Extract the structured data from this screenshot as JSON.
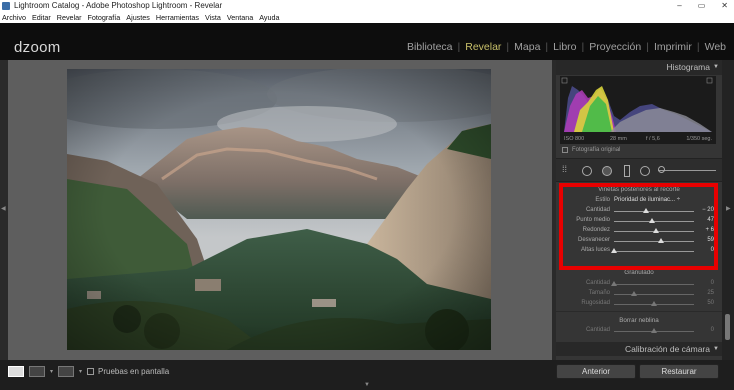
{
  "window": {
    "title": "Lightroom Catalog - Adobe Photoshop Lightroom - Revelar",
    "controls": [
      "–",
      "▭",
      "✕"
    ]
  },
  "menu": [
    "Archivo",
    "Editar",
    "Revelar",
    "Fotografía",
    "Ajustes",
    "Herramientas",
    "Vista",
    "Ventana",
    "Ayuda"
  ],
  "brand": "dzoom",
  "modules": [
    {
      "label": "Biblioteca",
      "active": false
    },
    {
      "label": "Revelar",
      "active": true
    },
    {
      "label": "Mapa",
      "active": false
    },
    {
      "label": "Libro",
      "active": false
    },
    {
      "label": "Proyección",
      "active": false
    },
    {
      "label": "Imprimir",
      "active": false
    },
    {
      "label": "Web",
      "active": false
    }
  ],
  "panel": {
    "histogram": {
      "title": "Histograma",
      "iso": "ISO 800",
      "focal": "28 mm",
      "aperture": "f / 5,6",
      "shutter": "1/350 seg.",
      "original_label": "Fotografía original"
    },
    "vignette": {
      "title": "Viñetas posteriores al recorte",
      "style_label": "Estilo",
      "style_value": "Prioridad de iluminac... ÷",
      "sliders": [
        {
          "label": "Cantidad",
          "value": "− 20",
          "pos": 0.4
        },
        {
          "label": "Punto medio",
          "value": "47",
          "pos": 0.47
        },
        {
          "label": "Redondez",
          "value": "+ 6",
          "pos": 0.53
        },
        {
          "label": "Desvanecer",
          "value": "59",
          "pos": 0.59
        },
        {
          "label": "Altas luces",
          "value": "0",
          "pos": 0.0
        }
      ]
    },
    "grain": {
      "title": "Granulado",
      "sliders": [
        {
          "label": "Cantidad",
          "value": "0",
          "pos": 0.0
        },
        {
          "label": "Tamaño",
          "value": "25",
          "pos": 0.25
        },
        {
          "label": "Rugosidad",
          "value": "50",
          "pos": 0.5
        }
      ]
    },
    "dehaze": {
      "title": "Borrar neblina",
      "sliders": [
        {
          "label": "Cantidad",
          "value": "0",
          "pos": 0.5
        }
      ]
    },
    "calibration_title": "Calibración de cámara"
  },
  "bottom": {
    "soft_proof": "Pruebas en pantalla",
    "prev_button": "Anterior",
    "reset_button": "Restaurar"
  },
  "colors": {
    "accent": "#c8c06a",
    "highlight_box": "#e80000"
  }
}
